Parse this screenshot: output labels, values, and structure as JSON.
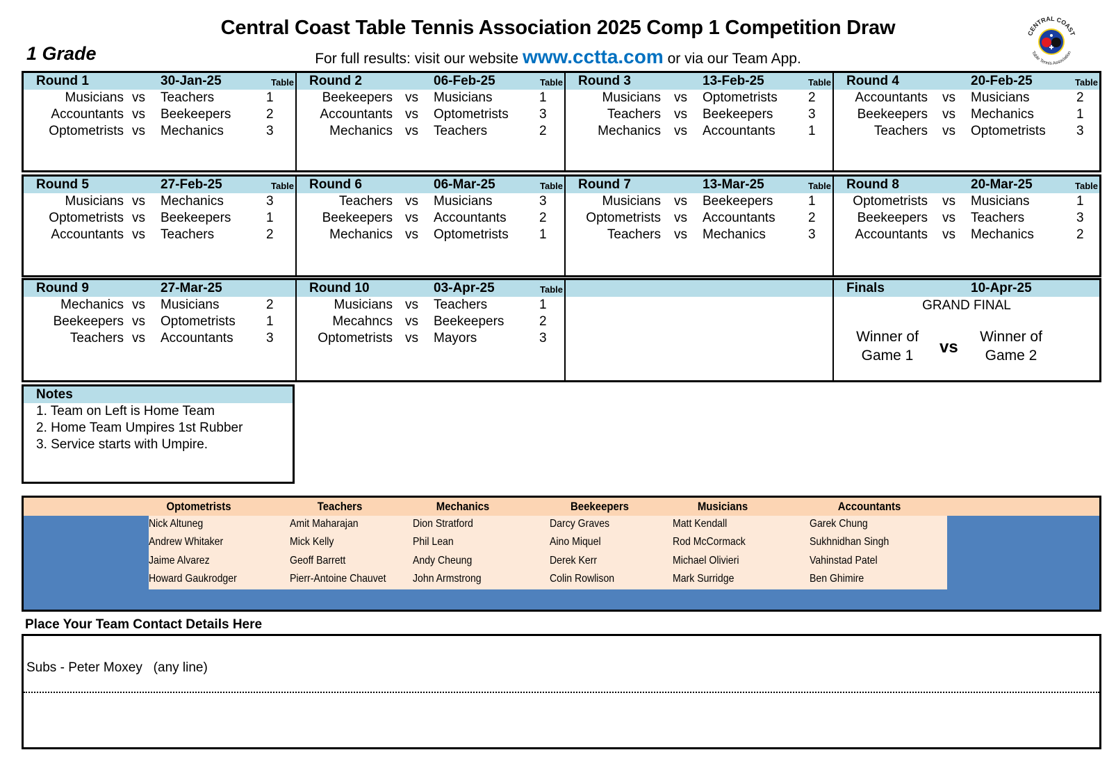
{
  "header": {
    "title": "Central Coast Table Tennis Association 2025 Comp 1 Competition Draw",
    "grade": "1 Grade",
    "subtitle_prefix": "For full results: visit our website ",
    "website": "www.cctta.com",
    "subtitle_suffix": " or via our Team App.",
    "logo": {
      "icon": "cctta-logo-icon",
      "ring_text_top": "CENTRAL COAST",
      "ring_text_bottom": "Table Tennis Association",
      "colors": {
        "ring": "#1f1f1f",
        "inner": "#1a3fa0",
        "ball_red": "#e31b23",
        "ball_black": "#111111",
        "rim": "#f3d21b"
      }
    }
  },
  "colors": {
    "round_header_bg": "#b7dde8",
    "team_header_bg": "#fcd5b4",
    "player_bg": "#fde9d9",
    "player_frame_bg": "#4f81bd",
    "website": "#0070c0"
  },
  "labels": {
    "table": "Table",
    "vs": "vs"
  },
  "rounds": [
    {
      "name": "Round 1",
      "date": "30-Jan-25",
      "table_label": "Table",
      "matches": [
        {
          "home": "Musicians",
          "away": "Teachers",
          "table": "1"
        },
        {
          "home": "Accountants",
          "away": "Beekeepers",
          "table": "2"
        },
        {
          "home": "Optometrists",
          "away": "Mechanics",
          "table": "3"
        }
      ]
    },
    {
      "name": "Round 2",
      "date": "06-Feb-25",
      "table_label": "Table",
      "matches": [
        {
          "home": "Beekeepers",
          "away": "Musicians",
          "table": "1"
        },
        {
          "home": "Accountants",
          "away": "Optometrists",
          "table": "3"
        },
        {
          "home": "Mechanics",
          "away": "Teachers",
          "table": "2"
        }
      ]
    },
    {
      "name": "Round 3",
      "date": "13-Feb-25",
      "table_label": "Table",
      "matches": [
        {
          "home": "Musicians",
          "away": "Optometrists",
          "table": "2"
        },
        {
          "home": "Teachers",
          "away": "Beekeepers",
          "table": "3"
        },
        {
          "home": "Mechanics",
          "away": "Accountants",
          "table": "1"
        }
      ]
    },
    {
      "name": "Round 4",
      "date": "20-Feb-25",
      "table_label": "Table",
      "matches": [
        {
          "home": "Accountants",
          "away": "Musicians",
          "table": "2"
        },
        {
          "home": "Beekeepers",
          "away": "Mechanics",
          "table": "1"
        },
        {
          "home": "Teachers",
          "away": "Optometrists",
          "table": "3"
        }
      ]
    },
    {
      "name": "Round 5",
      "date": "27-Feb-25",
      "table_label": "Table",
      "matches": [
        {
          "home": "Musicians",
          "away": "Mechanics",
          "table": "3"
        },
        {
          "home": "Optometrists",
          "away": "Beekeepers",
          "table": "1"
        },
        {
          "home": "Accountants",
          "away": "Teachers",
          "table": "2"
        }
      ]
    },
    {
      "name": "Round 6",
      "date": "06-Mar-25",
      "table_label": "Table",
      "matches": [
        {
          "home": "Teachers",
          "away": "Musicians",
          "table": "3"
        },
        {
          "home": "Beekeepers",
          "away": "Accountants",
          "table": "2"
        },
        {
          "home": "Mechanics",
          "away": "Optometrists",
          "table": "1"
        }
      ]
    },
    {
      "name": "Round 7",
      "date": "13-Mar-25",
      "table_label": "Table",
      "matches": [
        {
          "home": "Musicians",
          "away": "Beekeepers",
          "table": "1"
        },
        {
          "home": "Optometrists",
          "away": "Accountants",
          "table": "2"
        },
        {
          "home": "Teachers",
          "away": "Mechanics",
          "table": "3"
        }
      ]
    },
    {
      "name": "Round 8",
      "date": "20-Mar-25",
      "table_label": "Table",
      "matches": [
        {
          "home": "Optometrists",
          "away": "Musicians",
          "table": "1"
        },
        {
          "home": "Beekeepers",
          "away": "Teachers",
          "table": "3"
        },
        {
          "home": "Accountants",
          "away": "Mechanics",
          "table": "2"
        }
      ]
    },
    {
      "name": "Round 9",
      "date": "27-Mar-25",
      "table_label": "",
      "matches": [
        {
          "home": "Mechanics",
          "away": "Musicians",
          "table": "2"
        },
        {
          "home": "Beekeepers",
          "away": "Optometrists",
          "table": "1"
        },
        {
          "home": "Teachers",
          "away": "Accountants",
          "table": "3"
        }
      ]
    },
    {
      "name": "Round 10",
      "date": "03-Apr-25",
      "table_label": "Table",
      "matches": [
        {
          "home": "Musicians",
          "away": "Teachers",
          "table": "1"
        },
        {
          "home": "Mecahncs",
          "away": "Beekeepers",
          "table": "2"
        },
        {
          "home": "Optometrists",
          "away": "Mayors",
          "table": "3"
        }
      ]
    }
  ],
  "finals": {
    "name": "Finals",
    "date": "10-Apr-25",
    "title": "GRAND FINAL",
    "left_line1": "Winner of",
    "left_line2": "Game 1",
    "vs": "vs",
    "right_line1": "Winner of",
    "right_line2": "Game 2"
  },
  "notes": {
    "title": "Notes",
    "items": [
      "1. Team on Left is Home Team",
      "2. Home Team Umpires 1st Rubber",
      "3. Service starts with Umpire."
    ]
  },
  "teams": [
    {
      "name": "Optometrists",
      "players": [
        "Nick Altuneg",
        "Andrew Whitaker",
        "Jaime Alvarez",
        "Howard Gaukrodger"
      ]
    },
    {
      "name": "Teachers",
      "players": [
        "Amit Maharajan",
        "Mick Kelly",
        "Geoff Barrett",
        "Pierr-Antoine Chauvet"
      ]
    },
    {
      "name": "Mechanics",
      "players": [
        "Dion Stratford",
        "Phil Lean",
        "Andy Cheung",
        "John Armstrong"
      ]
    },
    {
      "name": "Beekeepers",
      "players": [
        "Darcy Graves",
        "Aino Miquel",
        "Derek Kerr",
        "Colin Rowlison"
      ]
    },
    {
      "name": "Musicians",
      "players": [
        "Matt Kendall",
        "Rod McCormack",
        "Michael Olivieri",
        "Mark Surridge"
      ]
    },
    {
      "name": "Accountants",
      "players": [
        "Garek Chung",
        "Sukhnidhan Singh",
        "Vahinstad Patel",
        "Ben Ghimire"
      ]
    }
  ],
  "contact": {
    "label": "Place Your Team Contact Details Here",
    "subs": "Subs - Peter Moxey   (any line)"
  }
}
